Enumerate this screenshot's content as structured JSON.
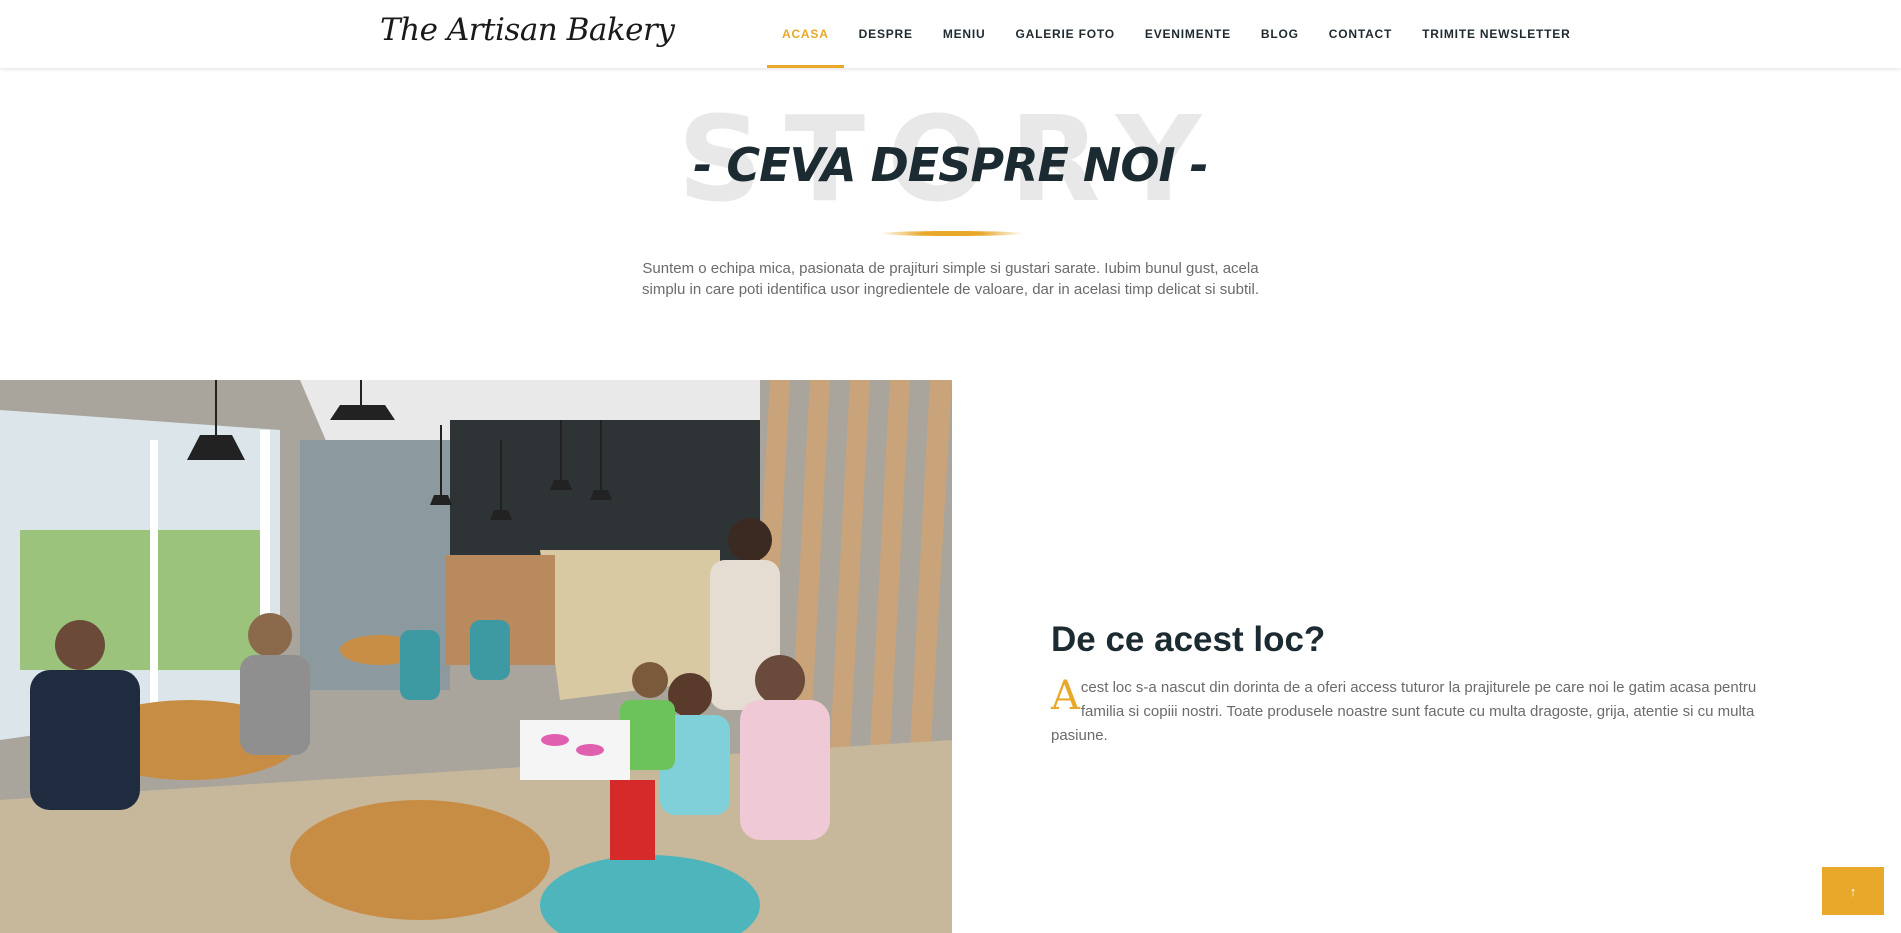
{
  "header": {
    "logo": "The Artisan Bakery",
    "nav": [
      {
        "label": "ACASA",
        "active": true
      },
      {
        "label": "DESPRE"
      },
      {
        "label": "MENIU"
      },
      {
        "label": "GALERIE FOTO"
      },
      {
        "label": "EVENIMENTE"
      },
      {
        "label": "BLOG"
      },
      {
        "label": "CONTACT"
      },
      {
        "label": "TRIMITE NEWSLETTER"
      }
    ]
  },
  "intro": {
    "watermark": "STORY",
    "title": "- CEVA DESPRE NOI -",
    "text": "Suntem o echipa mica, pasionata de prajituri simple si gustari sarate. Iubim bunul gust, acela simplu in care poti identifica usor ingredientele de valoare, dar in acelasi timp delicat si subtil."
  },
  "about": {
    "heading": "De ce acest loc?",
    "drop_cap": "A",
    "text": "cest loc s-a nascut din dorinta de a oferi access tuturor la prajiturele pe care noi le gatim acasa pentru familia si copiii nostri. Toate produsele noastre sunt facute cu multa dragoste, grija, atentie si cu multa pasiune."
  },
  "back_to_top_icon": "arrow-up-icon",
  "back_to_top_glyph": "↑",
  "colors": {
    "accent": "#e8a82a",
    "heading": "#1c2a31",
    "body_text": "#6b6b6b"
  }
}
